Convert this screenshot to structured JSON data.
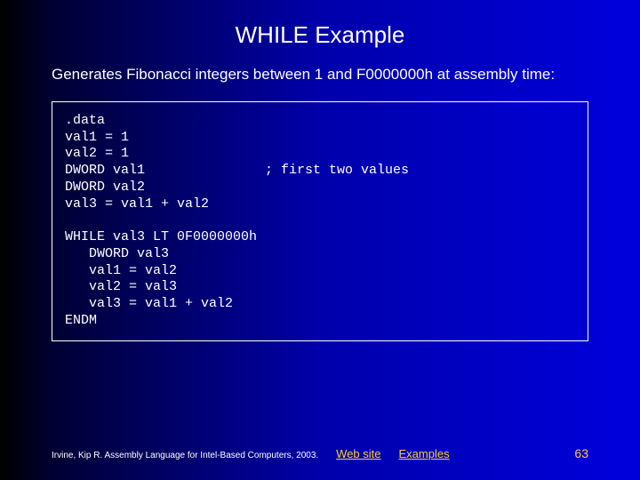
{
  "title": "WHILE Example",
  "body": "Generates Fibonacci integers between 1 and F0000000h at assembly time:",
  "code": ".data\nval1 = 1\nval2 = 1\nDWORD val1               ; first two values\nDWORD val2\nval3 = val1 + val2\n\nWHILE val3 LT 0F0000000h\n   DWORD val3\n   val1 = val2\n   val2 = val3\n   val3 = val1 + val2\nENDM",
  "footer": {
    "credit": "Irvine, Kip R. Assembly Language for Intel-Based Computers, 2003.",
    "link1": "Web site",
    "link2": "Examples",
    "page": "63"
  }
}
